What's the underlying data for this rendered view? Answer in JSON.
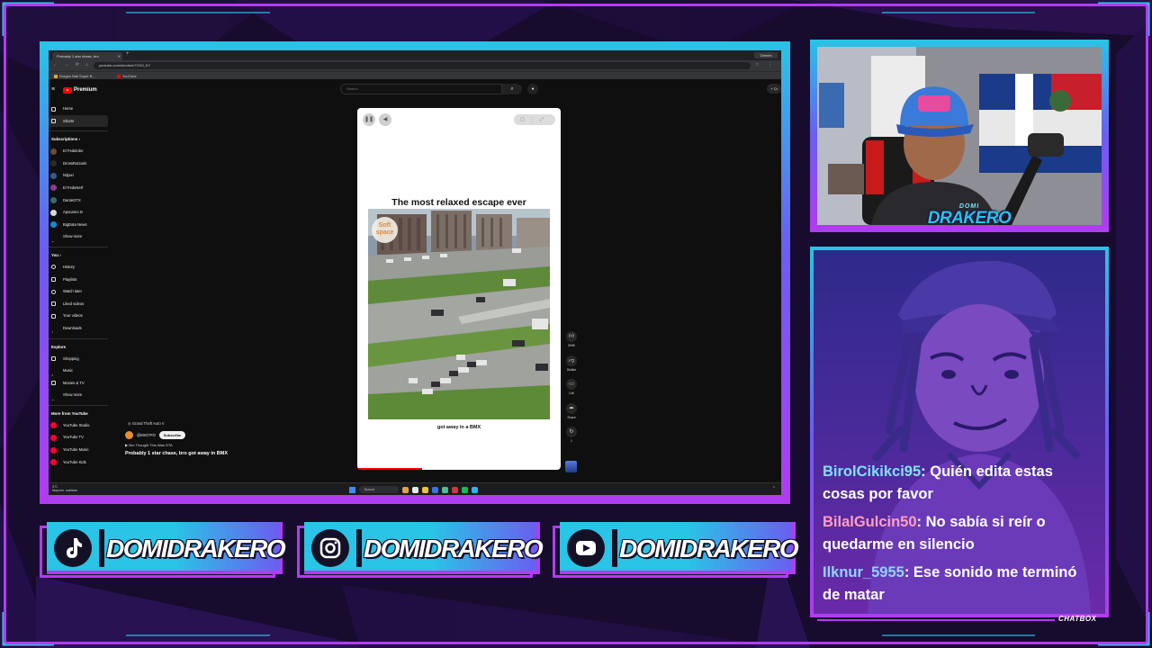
{
  "browser": {
    "tab_title": "Probably 1 star chase, bro",
    "url": "youtube.com/shorts/m7GX9_KY",
    "bookmarks": [
      "Dragon Ball Super B...",
      "YouTube"
    ],
    "window_button": "Gemini"
  },
  "youtube": {
    "brand": "Premium",
    "search_placeholder": "Search",
    "create_label": "Cr",
    "sidebar": {
      "main": [
        {
          "label": "Home"
        },
        {
          "label": "Shorts",
          "active": true
        }
      ],
      "subscriptions_heading": "Subscriptions",
      "subscriptions": [
        {
          "label": "El Fedelobo",
          "color": "#6b4a3a"
        },
        {
          "label": "DrossRotzank",
          "color": "#2a2a2a"
        },
        {
          "label": "N3jaxi",
          "color": "#3a5a8a"
        },
        {
          "label": "El FedeNerf",
          "color": "#8a3a8a"
        },
        {
          "label": "DanteGTX",
          "color": "#3a6a6a"
        },
        {
          "label": "Apocamo tv",
          "color": "#d8d8d8"
        },
        {
          "label": "BigData News",
          "color": "#1a8ac8"
        },
        {
          "label": "Show more"
        }
      ],
      "you_heading": "You",
      "you": [
        {
          "label": "History"
        },
        {
          "label": "Playlists"
        },
        {
          "label": "Watch later"
        },
        {
          "label": "Liked videos"
        },
        {
          "label": "Your videos"
        },
        {
          "label": "Downloads"
        }
      ],
      "explore_heading": "Explore",
      "explore": [
        {
          "label": "Shopping"
        },
        {
          "label": "Music"
        },
        {
          "label": "Movies & TV"
        },
        {
          "label": "Show more"
        }
      ],
      "more_heading": "More from YouTube",
      "more": [
        {
          "label": "YouTube Studio"
        },
        {
          "label": "YouTube TV"
        },
        {
          "label": "YouTube Music"
        },
        {
          "label": "YouTube Kids"
        }
      ]
    },
    "short": {
      "caption": "The most relaxed escape ever",
      "subtitle": "got away in a BMX",
      "watermark_line1": "Soft",
      "watermark_line2": "space",
      "tag": "Grand Theft Auto V",
      "channel": "@MrGTFO",
      "subscribe": "Subscribe",
      "music": "Bro Thought This Was GTA",
      "title": "Probably 1 star chase, bro got away in BMX",
      "actions": [
        {
          "icon": "like-icon",
          "label": "309K"
        },
        {
          "icon": "dislike-icon",
          "label": "Dislike"
        },
        {
          "icon": "comment-icon",
          "label": "14K"
        },
        {
          "icon": "share-icon",
          "label": "Share"
        },
        {
          "icon": "remix-icon",
          "label": "1"
        }
      ]
    }
  },
  "taskbar": {
    "weather_temp": "3°C",
    "weather_desc": "Mayorm. nublado",
    "search_placeholder": "Buscar",
    "apps": [
      "#d9a441",
      "#e8e8e8",
      "#e8c23a",
      "#2f7ad9",
      "#4ac18e",
      "#cc3b3b",
      "#1db954",
      "#34b3e4"
    ]
  },
  "streamer": {
    "logo_small": "DOMI",
    "logo_big": "DRAKERO"
  },
  "chat": {
    "label": "CHATBOX",
    "messages": [
      {
        "user": "BirolCikikci95",
        "text": "Quién edita estas cosas por favor",
        "color": "#7ee3ff"
      },
      {
        "user": "BilalGulcin50",
        "text": "No sabía si reír o quedarme en silencio",
        "color": "#ff9fc0"
      },
      {
        "user": "Ilknur_5955",
        "text": "Ese sonido me terminó de matar",
        "color": "#8fd6ff"
      }
    ]
  },
  "socials": [
    {
      "platform": "tiktok",
      "icon": "tiktok-icon",
      "handle": "DOMIDRAKERO"
    },
    {
      "platform": "instagram",
      "icon": "instagram-icon",
      "handle": "DOMIDRAKERO"
    },
    {
      "platform": "youtube",
      "icon": "youtube-icon",
      "handle": "DOMIDRAKERO"
    }
  ],
  "colors": {
    "cyan": "#29c4e6",
    "purple": "#b13cf0",
    "indigo": "#6a5ef0",
    "background": "#120a25"
  }
}
